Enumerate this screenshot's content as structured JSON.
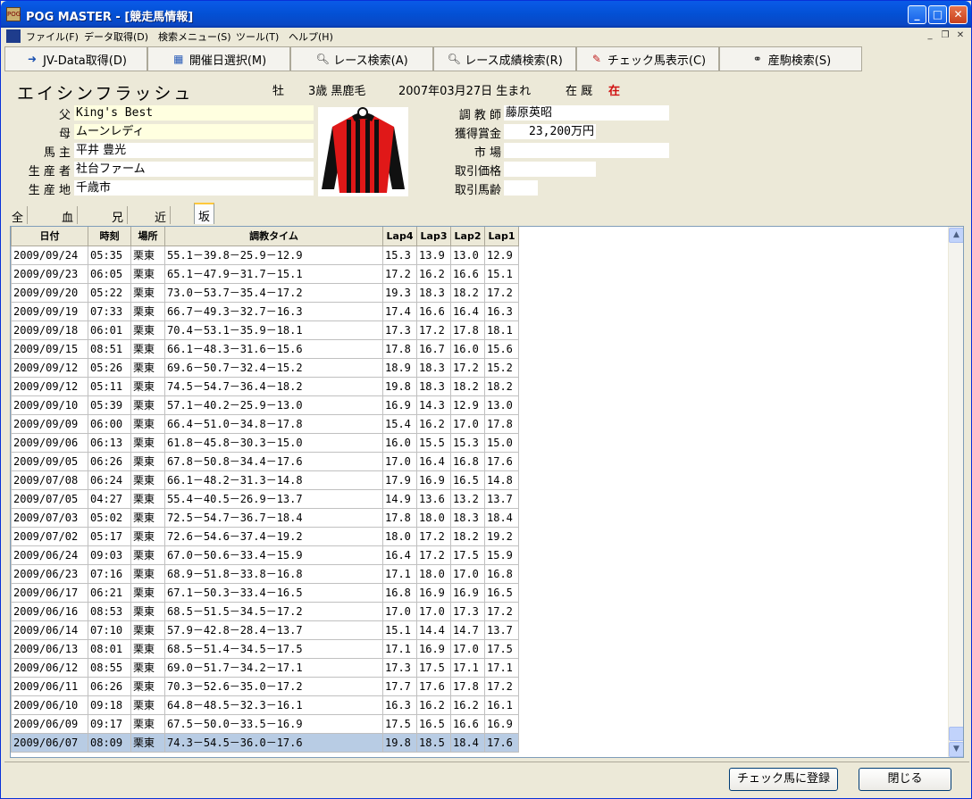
{
  "window": {
    "title": "POG MASTER - [競走馬情報]",
    "icon_text": "POG"
  },
  "menu": [
    "ファイル(F)",
    "データ取得(D)",
    "検索メニュー(S)",
    "ツール(T)",
    "ヘルプ(H)"
  ],
  "toolbar": [
    {
      "label": "JV-Data取得(D)",
      "icon": "arrow-icon"
    },
    {
      "label": "開催日選択(M)",
      "icon": "calendar-icon"
    },
    {
      "label": "レース検索(A)",
      "icon": "search-icon"
    },
    {
      "label": "レース成績検索(R)",
      "icon": "search-icon"
    },
    {
      "label": "チェック馬表示(C)",
      "icon": "check-icon"
    },
    {
      "label": "産駒検索(S)",
      "icon": "binoculars-icon"
    }
  ],
  "horse": {
    "name": "エイシンフラッシュ",
    "sex": "牡",
    "age_color": "3歳 黒鹿毛",
    "birth": "2007年03月27日 生まれ",
    "status_label": "在 厩",
    "status_value": "在",
    "sire_label": "父",
    "sire": "King's Best",
    "dam_label": "母",
    "dam": "ムーンレディ",
    "owner_label": "馬 主",
    "owner": "平井 豊光",
    "breeder_label": "生 産 者",
    "breeder": "社台ファーム",
    "birthplace_label": "生 産 地",
    "birthplace": "千歳市",
    "trainer_label": "調 教 師",
    "trainer": "藤原英昭",
    "earnings_label": "獲得賞金",
    "earnings": "23,200万円",
    "market_label": "市 場",
    "market": "",
    "price_label": "取引価格",
    "price": "",
    "trade_age_label": "取引馬齢",
    "trade_age": ""
  },
  "tabs": [
    "全成績",
    "血統表",
    "兄弟",
    "近親",
    "坂路調教一覧"
  ],
  "active_tab": 4,
  "grid": {
    "headers": [
      "日付",
      "時刻",
      "場所",
      "調教タイム",
      "Lap4",
      "Lap3",
      "Lap2",
      "Lap1"
    ],
    "rows": [
      [
        "2009/09/24",
        "05:35",
        "栗東",
        "55.1－39.8－25.9－12.9",
        "15.3",
        "13.9",
        "13.0",
        "12.9"
      ],
      [
        "2009/09/23",
        "06:05",
        "栗東",
        "65.1－47.9－31.7－15.1",
        "17.2",
        "16.2",
        "16.6",
        "15.1"
      ],
      [
        "2009/09/20",
        "05:22",
        "栗東",
        "73.0－53.7－35.4－17.2",
        "19.3",
        "18.3",
        "18.2",
        "17.2"
      ],
      [
        "2009/09/19",
        "07:33",
        "栗東",
        "66.7－49.3－32.7－16.3",
        "17.4",
        "16.6",
        "16.4",
        "16.3"
      ],
      [
        "2009/09/18",
        "06:01",
        "栗東",
        "70.4－53.1－35.9－18.1",
        "17.3",
        "17.2",
        "17.8",
        "18.1"
      ],
      [
        "2009/09/15",
        "08:51",
        "栗東",
        "66.1－48.3－31.6－15.6",
        "17.8",
        "16.7",
        "16.0",
        "15.6"
      ],
      [
        "2009/09/12",
        "05:26",
        "栗東",
        "69.6－50.7－32.4－15.2",
        "18.9",
        "18.3",
        "17.2",
        "15.2"
      ],
      [
        "2009/09/12",
        "05:11",
        "栗東",
        "74.5－54.7－36.4－18.2",
        "19.8",
        "18.3",
        "18.2",
        "18.2"
      ],
      [
        "2009/09/10",
        "05:39",
        "栗東",
        "57.1－40.2－25.9－13.0",
        "16.9",
        "14.3",
        "12.9",
        "13.0"
      ],
      [
        "2009/09/09",
        "06:00",
        "栗東",
        "66.4－51.0－34.8－17.8",
        "15.4",
        "16.2",
        "17.0",
        "17.8"
      ],
      [
        "2009/09/06",
        "06:13",
        "栗東",
        "61.8－45.8－30.3－15.0",
        "16.0",
        "15.5",
        "15.3",
        "15.0"
      ],
      [
        "2009/09/05",
        "06:26",
        "栗東",
        "67.8－50.8－34.4－17.6",
        "17.0",
        "16.4",
        "16.8",
        "17.6"
      ],
      [
        "2009/07/08",
        "06:24",
        "栗東",
        "66.1－48.2－31.3－14.8",
        "17.9",
        "16.9",
        "16.5",
        "14.8"
      ],
      [
        "2009/07/05",
        "04:27",
        "栗東",
        "55.4－40.5－26.9－13.7",
        "14.9",
        "13.6",
        "13.2",
        "13.7"
      ],
      [
        "2009/07/03",
        "05:02",
        "栗東",
        "72.5－54.7－36.7－18.4",
        "17.8",
        "18.0",
        "18.3",
        "18.4"
      ],
      [
        "2009/07/02",
        "05:17",
        "栗東",
        "72.6－54.6－37.4－19.2",
        "18.0",
        "17.2",
        "18.2",
        "19.2"
      ],
      [
        "2009/06/24",
        "09:03",
        "栗東",
        "67.0－50.6－33.4－15.9",
        "16.4",
        "17.2",
        "17.5",
        "15.9"
      ],
      [
        "2009/06/23",
        "07:16",
        "栗東",
        "68.9－51.8－33.8－16.8",
        "17.1",
        "18.0",
        "17.0",
        "16.8"
      ],
      [
        "2009/06/17",
        "06:21",
        "栗東",
        "67.1－50.3－33.4－16.5",
        "16.8",
        "16.9",
        "16.9",
        "16.5"
      ],
      [
        "2009/06/16",
        "08:53",
        "栗東",
        "68.5－51.5－34.5－17.2",
        "17.0",
        "17.0",
        "17.3",
        "17.2"
      ],
      [
        "2009/06/14",
        "07:10",
        "栗東",
        "57.9－42.8－28.4－13.7",
        "15.1",
        "14.4",
        "14.7",
        "13.7"
      ],
      [
        "2009/06/13",
        "08:01",
        "栗東",
        "68.5－51.4－34.5－17.5",
        "17.1",
        "16.9",
        "17.0",
        "17.5"
      ],
      [
        "2009/06/12",
        "08:55",
        "栗東",
        "69.0－51.7－34.2－17.1",
        "17.3",
        "17.5",
        "17.1",
        "17.1"
      ],
      [
        "2009/06/11",
        "06:26",
        "栗東",
        "70.3－52.6－35.0－17.2",
        "17.7",
        "17.6",
        "17.8",
        "17.2"
      ],
      [
        "2009/06/10",
        "09:18",
        "栗東",
        "64.8－48.5－32.3－16.1",
        "16.3",
        "16.2",
        "16.2",
        "16.1"
      ],
      [
        "2009/06/09",
        "09:17",
        "栗東",
        "67.5－50.0－33.5－16.9",
        "17.5",
        "16.5",
        "16.6",
        "16.9"
      ],
      [
        "2009/06/07",
        "08:09",
        "栗東",
        "74.3－54.5－36.0－17.6",
        "19.8",
        "18.5",
        "18.4",
        "17.6"
      ]
    ],
    "selected_row": 26
  },
  "footer": {
    "register_label": "チェック馬に登録",
    "close_label": "閉じる"
  },
  "colors": {
    "titlebar": "#0350d4",
    "status_red": "#d01010",
    "selected_row": "#b8cce4",
    "silk_red": "#e01818",
    "silk_black": "#101010"
  }
}
